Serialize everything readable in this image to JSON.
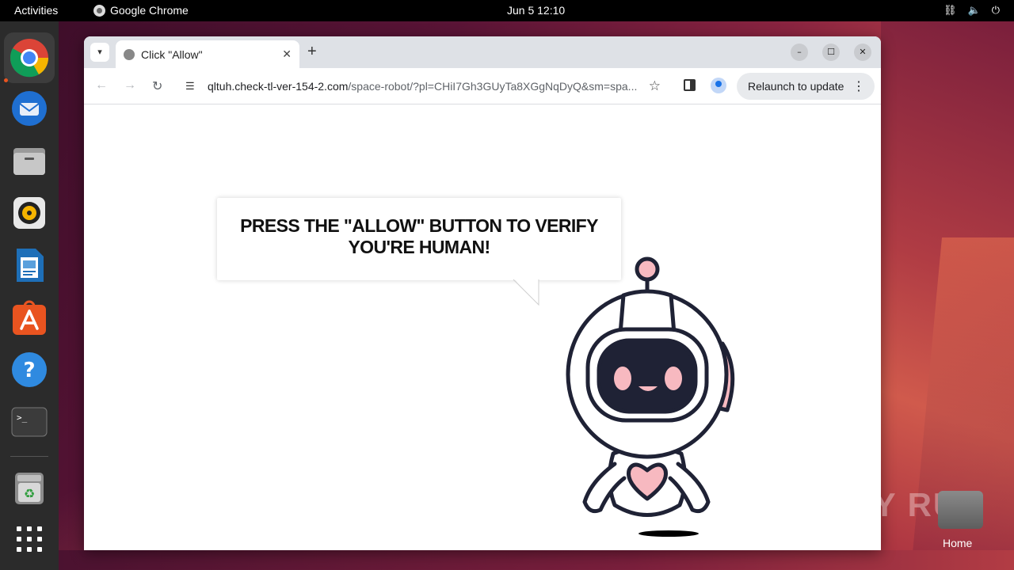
{
  "topbar": {
    "activities": "Activities",
    "app_name": "Google Chrome",
    "clock": "Jun 5  12:10"
  },
  "dock": {
    "items": [
      "chrome-icon",
      "thunderbird-icon",
      "files-icon",
      "rhythmbox-icon",
      "writer-icon",
      "app-center-icon",
      "help-icon",
      "terminal-icon",
      "trash-icon",
      "app-grid-icon"
    ]
  },
  "browser": {
    "tab_title": "Click \"Allow\"",
    "url_host": "qltuh.check-tl-ver-154-2.com",
    "url_path": "/space-robot/?pl=CHiI7Gh3GUyTa8XGgNqDyQ&sm=spa...",
    "relaunch_label": "Relaunch to update"
  },
  "page": {
    "message": "PRESS THE \"ALLOW\" BUTTON TO VERIFY YOU'RE HUMAN!"
  },
  "desktop": {
    "watermark": "ANY RUN",
    "home_label": "Home"
  },
  "colors": {
    "accent": "#e95420",
    "robot_outline": "#1f2235",
    "robot_pink": "#f7b9c0"
  }
}
